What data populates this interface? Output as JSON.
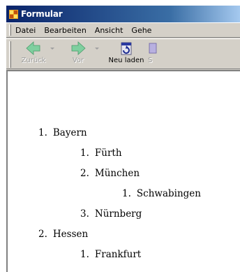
{
  "window": {
    "title": "Formular"
  },
  "menubar": {
    "items": [
      {
        "label": "Datei"
      },
      {
        "label": "Bearbeiten"
      },
      {
        "label": "Ansicht"
      },
      {
        "label": "Gehe"
      }
    ]
  },
  "toolbar": {
    "back": {
      "label": "Zurück",
      "enabled": false
    },
    "forward": {
      "label": "Vor",
      "enabled": false
    },
    "reload": {
      "label": "Neu laden",
      "enabled": true
    },
    "partial_label": "S"
  },
  "content": {
    "list": [
      {
        "number": "1.",
        "label": "Bayern",
        "children": [
          {
            "number": "1.",
            "label": "Fürth"
          },
          {
            "number": "2.",
            "label": "München",
            "children": [
              {
                "number": "1.",
                "label": "Schwabingen"
              }
            ]
          },
          {
            "number": "3.",
            "label": "Nürnberg"
          }
        ]
      },
      {
        "number": "2.",
        "label": "Hessen",
        "children": [
          {
            "number": "1.",
            "label": "Frankfurt"
          }
        ]
      }
    ]
  },
  "colors": {
    "titlebar_start": "#0a246a",
    "titlebar_end": "#a6caf0",
    "chrome": "#d4d0c8",
    "content_bg": "#ffffff",
    "nav_arrow_green": "#3cb371"
  },
  "icons": {
    "app": "app-window-icon",
    "back": "back-arrow-icon",
    "forward": "forward-arrow-icon",
    "reload": "reload-page-icon"
  }
}
